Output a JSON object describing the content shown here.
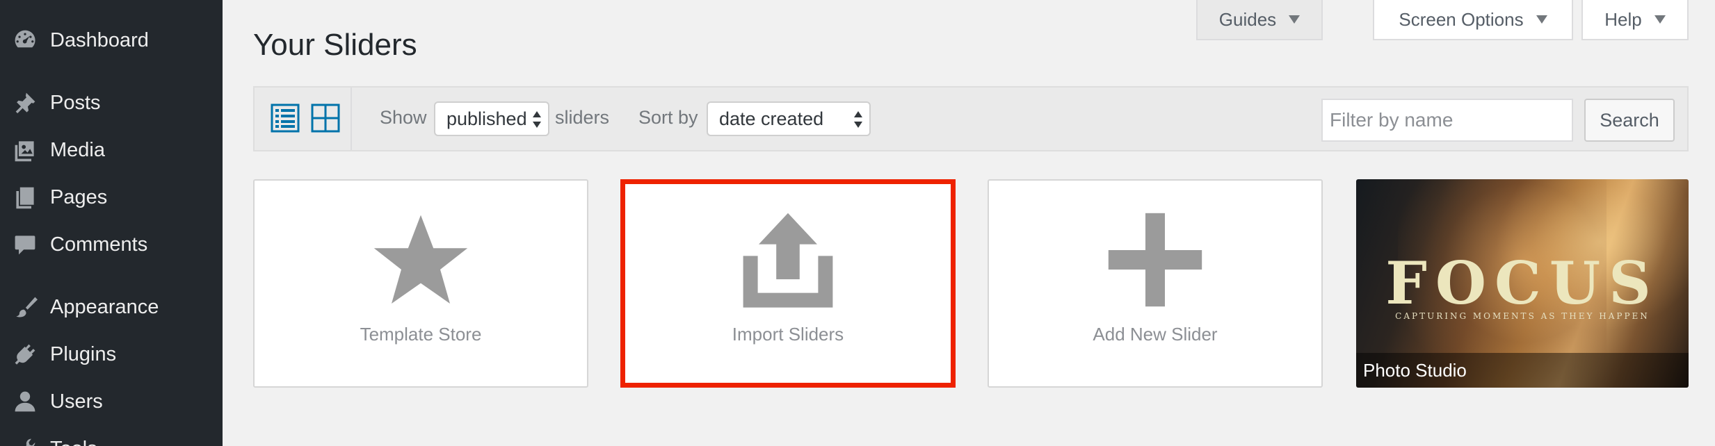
{
  "sidebar": {
    "items": [
      {
        "label": "Dashboard",
        "icon": "dashboard-icon"
      },
      {
        "label": "Posts",
        "icon": "pin-icon"
      },
      {
        "label": "Media",
        "icon": "media-icon"
      },
      {
        "label": "Pages",
        "icon": "pages-icon"
      },
      {
        "label": "Comments",
        "icon": "comment-icon"
      },
      {
        "label": "Appearance",
        "icon": "brush-icon"
      },
      {
        "label": "Plugins",
        "icon": "plugin-icon"
      },
      {
        "label": "Users",
        "icon": "user-icon"
      },
      {
        "label": "Tools",
        "icon": "wrench-icon"
      }
    ]
  },
  "header": {
    "guides_label": "Guides",
    "screen_options_label": "Screen Options",
    "help_label": "Help",
    "title": "Your Sliders"
  },
  "filters": {
    "show_label": "Show",
    "status_value": "published",
    "sliders_label": "sliders",
    "sort_label": "Sort by",
    "sort_value": "date created",
    "filter_placeholder": "Filter by name",
    "search_label": "Search"
  },
  "cards": [
    {
      "label": "Template Store",
      "icon": "star-icon"
    },
    {
      "label": "Import Sliders",
      "icon": "upload-icon"
    },
    {
      "label": "Add New Slider",
      "icon": "plus-icon"
    }
  ],
  "slider_thumb": {
    "title": "FOCUS",
    "tagline": "CAPTURING MOMENTS AS THEY HAPPEN",
    "caption": "Photo Studio"
  },
  "colors": {
    "sidebar_bg": "#23282d",
    "accent_blue": "#0073aa",
    "highlight_red": "#ee2200"
  }
}
